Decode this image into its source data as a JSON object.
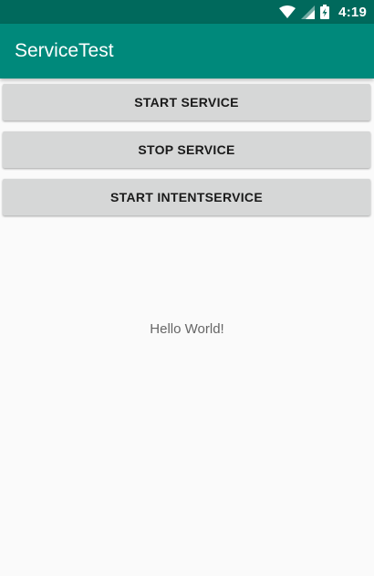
{
  "status_bar": {
    "time": "4:19",
    "icons": [
      "wifi-icon",
      "cellular-signal-icon",
      "battery-charging-icon"
    ],
    "background": "#00695c"
  },
  "app_bar": {
    "title": "ServiceTest",
    "background": "#00897b"
  },
  "buttons": {
    "start_service": "START SERVICE",
    "stop_service": "STOP SERVICE",
    "start_intentservice": "START INTENTSERVICE"
  },
  "content": {
    "hello_text": "Hello World!"
  }
}
